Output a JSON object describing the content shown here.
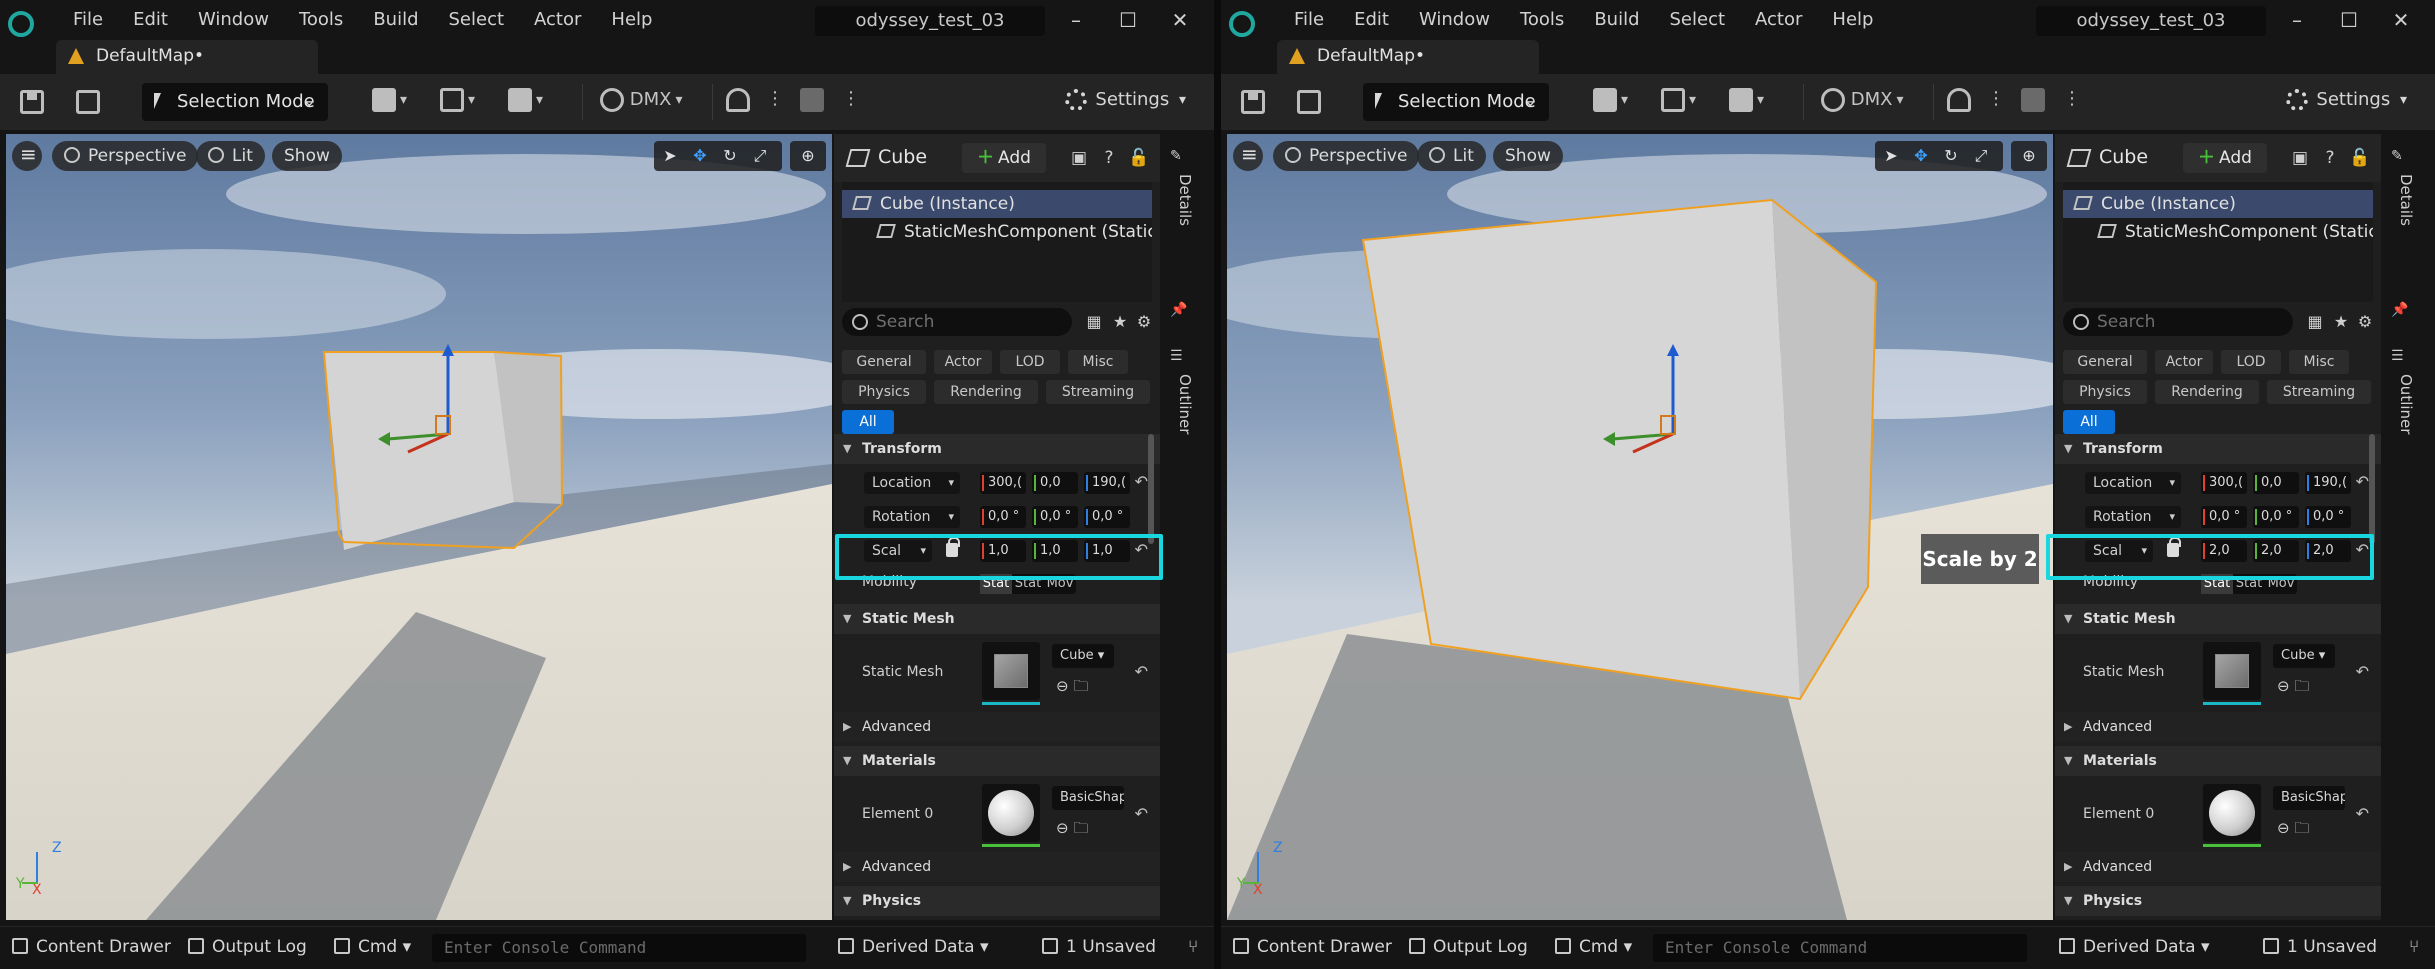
{
  "left": {
    "menu": [
      "File",
      "Edit",
      "Window",
      "Tools",
      "Build",
      "Select",
      "Actor",
      "Help"
    ],
    "project": "odyssey_test_03",
    "map_tab": "DefaultMap•",
    "toolbar": {
      "mode": "Selection Mode",
      "dmx": "DMX",
      "settings": "Settings"
    },
    "viewport": {
      "perspective": "Perspective",
      "lit": "Lit",
      "show": "Show",
      "axis_z": "Z",
      "axis_y": "Y",
      "axis_x": "X"
    },
    "details": {
      "title": "Cube",
      "add": "Add",
      "tree": [
        "Cube (Instance)",
        "StaticMeshComponent (StaticMes"
      ],
      "search_placeholder": "Search",
      "filters": [
        "General",
        "Actor",
        "LOD",
        "Misc",
        "Physics",
        "Rendering",
        "Streaming",
        "All"
      ],
      "transform_section": "Transform",
      "location_label": "Location",
      "location": [
        "300,(",
        "0,0",
        "190,("
      ],
      "rotation_label": "Rotation",
      "rotation": [
        "0,0 °",
        "0,0 °",
        "0,0 °"
      ],
      "scale_label": "Scal",
      "scale": [
        "1,0",
        "1,0",
        "1,0"
      ],
      "mobility_label": "Mobility",
      "mobility": [
        "Stat",
        "Stat",
        "Mov"
      ],
      "static_mesh_section": "Static Mesh",
      "static_mesh_label": "Static Mesh",
      "mesh_asset": "Cube",
      "advanced": "Advanced",
      "materials_section": "Materials",
      "element0_label": "Element 0",
      "material_asset": "BasicShape",
      "advanced2": "Advanced",
      "physics_section": "Physics"
    },
    "side_tabs": {
      "details": "Details",
      "outliner": "Outliner"
    },
    "status": {
      "content_drawer": "Content Drawer",
      "output_log": "Output Log",
      "cmd": "Cmd",
      "console_placeholder": "Enter Console Command",
      "derived_data": "Derived Data",
      "unsaved": "1 Unsaved"
    }
  },
  "right": {
    "menu": [
      "File",
      "Edit",
      "Window",
      "Tools",
      "Build",
      "Select",
      "Actor",
      "Help"
    ],
    "project": "odyssey_test_03",
    "map_tab": "DefaultMap•",
    "toolbar": {
      "mode": "Selection Mode",
      "dmx": "DMX",
      "settings": "Settings"
    },
    "viewport": {
      "perspective": "Perspective",
      "lit": "Lit",
      "show": "Show",
      "axis_z": "Z",
      "axis_y": "Y",
      "axis_x": "X"
    },
    "details": {
      "title": "Cube",
      "add": "Add",
      "tree": [
        "Cube (Instance)",
        "StaticMeshComponent (StaticMes"
      ],
      "search_placeholder": "Search",
      "filters": [
        "General",
        "Actor",
        "LOD",
        "Misc",
        "Physics",
        "Rendering",
        "Streaming",
        "All"
      ],
      "transform_section": "Transform",
      "location_label": "Location",
      "location": [
        "300,(",
        "0,0",
        "190,("
      ],
      "rotation_label": "Rotation",
      "rotation": [
        "0,0 °",
        "0,0 °",
        "0,0 °"
      ],
      "scale_label": "Scal",
      "scale": [
        "2,0",
        "2,0",
        "2,0"
      ],
      "mobility_label": "Mobility",
      "mobility": [
        "Stat",
        "Stat",
        "Mov"
      ],
      "static_mesh_section": "Static Mesh",
      "static_mesh_label": "Static Mesh",
      "mesh_asset": "Cube",
      "advanced": "Advanced",
      "materials_section": "Materials",
      "element0_label": "Element 0",
      "material_asset": "BasicShape",
      "advanced2": "Advanced",
      "physics_section": "Physics"
    },
    "side_tabs": {
      "details": "Details",
      "outliner": "Outliner"
    },
    "status": {
      "content_drawer": "Content Drawer",
      "output_log": "Output Log",
      "cmd": "Cmd",
      "console_placeholder": "Enter Console Command",
      "derived_data": "Derived Data",
      "unsaved": "1 Unsaved"
    }
  },
  "callout": "Scale by 2",
  "colors": {
    "highlight": "#19d6df",
    "selection_outline": "#f0a020",
    "accent": "#0a70d8"
  }
}
